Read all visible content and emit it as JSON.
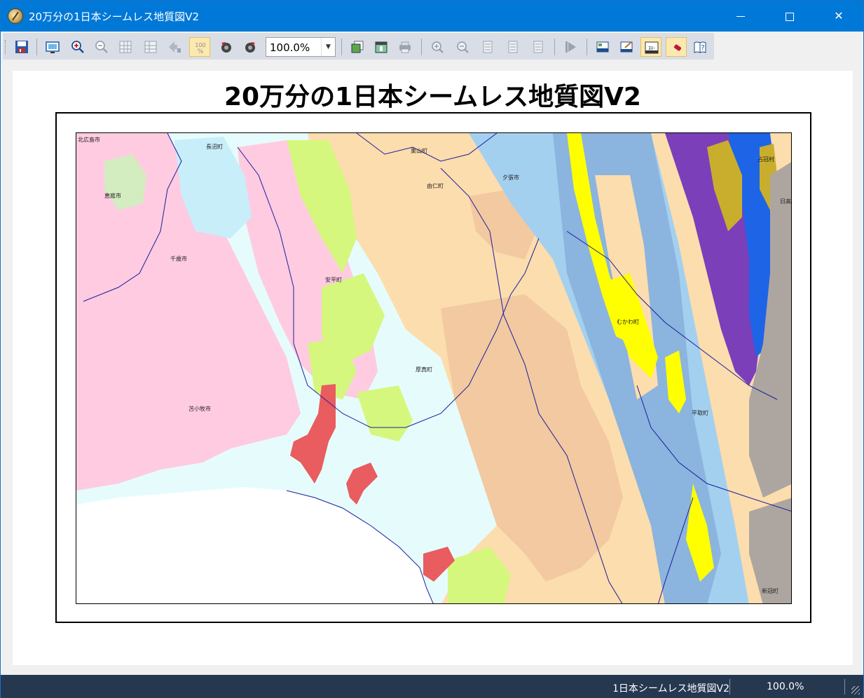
{
  "window": {
    "title": "20万分の1日本シームレス地質図V2",
    "minimize_label": "",
    "maximize_label": "",
    "close_label": "✕"
  },
  "toolbar": {
    "zoom_value": "100.0%",
    "zoom_arrow": "▼",
    "zoom_100_label": "100\n%",
    "buttons": [
      {
        "name": "save-map-button",
        "icon": "save-icon"
      },
      {
        "name": "fit-view-button",
        "icon": "fit-screen-icon"
      },
      {
        "name": "zoom-in-button",
        "icon": "zoom-in-icon"
      },
      {
        "name": "zoom-out-button",
        "icon": "zoom-out-icon"
      },
      {
        "name": "grid-view-button",
        "icon": "grid-icon"
      },
      {
        "name": "grid-view-alt-button",
        "icon": "grid-alt-icon"
      },
      {
        "name": "resize-button",
        "icon": "resize-arrow-icon"
      },
      {
        "name": "zoom-100-button",
        "icon": "zoom-100-icon"
      },
      {
        "name": "rotate-left-button",
        "icon": "rotate-left-icon"
      },
      {
        "name": "rotate-right-button",
        "icon": "rotate-right-icon"
      },
      {
        "name": "layer-button",
        "icon": "layer-icon"
      },
      {
        "name": "frame-button",
        "icon": "frame-icon"
      },
      {
        "name": "print-button",
        "icon": "printer-icon"
      },
      {
        "name": "search-button",
        "icon": "search-icon"
      },
      {
        "name": "search-minus-button",
        "icon": "search-minus-icon"
      },
      {
        "name": "page-button-1",
        "icon": "page-icon"
      },
      {
        "name": "page-button-2",
        "icon": "page-icon"
      },
      {
        "name": "page-button-3",
        "icon": "page-icon"
      },
      {
        "name": "play-button",
        "icon": "play-icon"
      },
      {
        "name": "legend-button",
        "icon": "legend-icon"
      },
      {
        "name": "edit-legend-button",
        "icon": "edit-icon"
      },
      {
        "name": "statusbar-toggle-button",
        "icon": "statusbar-icon",
        "label": "ｽﾃ-"
      },
      {
        "name": "eraser-button",
        "icon": "eraser-icon"
      },
      {
        "name": "help-button",
        "icon": "help-icon"
      }
    ]
  },
  "map": {
    "title": "20万分の1日本シームレス地質図V2",
    "colors": {
      "sea": "#ffffff",
      "alluvium": "#e6fcfc",
      "pink_volcanic": "#ffcbe1",
      "light_blue": "#c8eefa",
      "green_light": "#d3ecc0",
      "peach": "#fcddad",
      "tan": "#f2c9a0",
      "yellow_green": "#d6f77e",
      "yellow": "#ffff00",
      "blue": "#a4d0f0",
      "steel_blue": "#8bb4de",
      "deep_blue": "#1e64e6",
      "purple": "#7b3fba",
      "olive": "#c9ae2e",
      "gray": "#ada6a0",
      "red": "#e95c5f",
      "boundary": "#1c1c9e"
    },
    "city_labels": [
      {
        "name": "北広島市"
      },
      {
        "name": "長沼町"
      },
      {
        "name": "恵庭市"
      },
      {
        "name": "千歳市"
      },
      {
        "name": "栗山町"
      },
      {
        "name": "由仁町"
      },
      {
        "name": "夕張市"
      },
      {
        "name": "占冠村"
      },
      {
        "name": "日高"
      },
      {
        "name": "安平町"
      },
      {
        "name": "むかわ町"
      },
      {
        "name": "厚真町"
      },
      {
        "name": "苫小牧市"
      },
      {
        "name": "平取町"
      },
      {
        "name": "新冠町"
      }
    ]
  },
  "statusbar": {
    "title": "20万分の1日本シームレス地質図V2",
    "zoom": "100.0%"
  }
}
